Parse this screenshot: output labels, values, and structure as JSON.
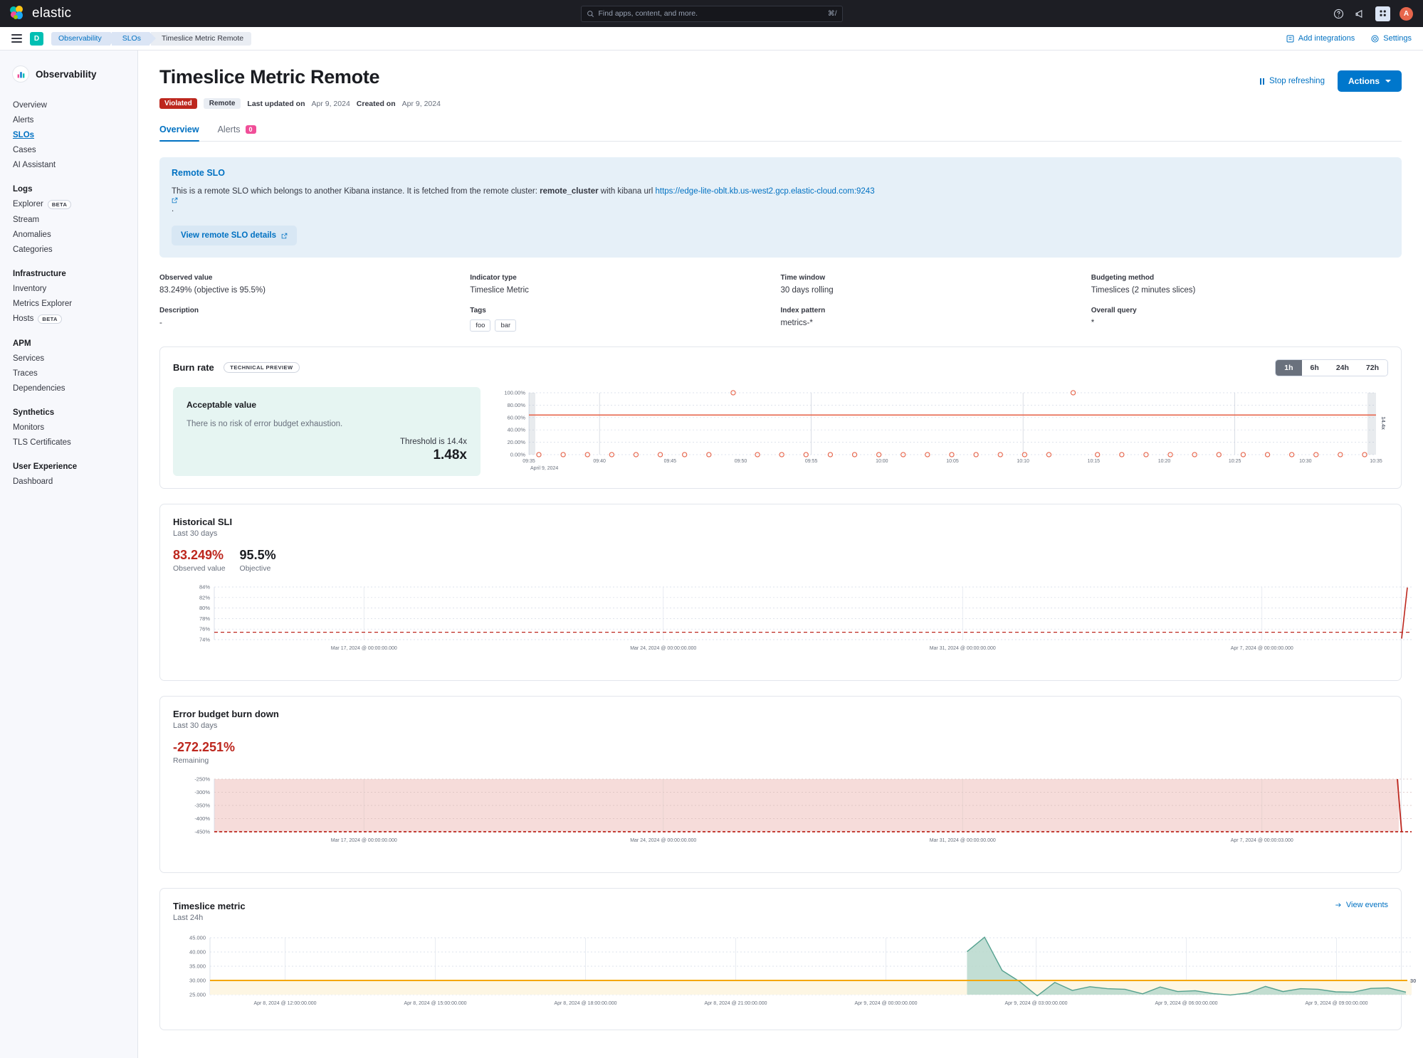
{
  "topbar": {
    "brand": "elastic",
    "search_placeholder": "Find apps, content, and more.",
    "search_shortcut": "⌘/",
    "avatar_initial": "A"
  },
  "breadcrumbs": {
    "space_initial": "D",
    "items": [
      "Observability",
      "SLOs",
      "Timeslice Metric Remote"
    ],
    "add_integrations": "Add integrations",
    "settings": "Settings"
  },
  "sidebar": {
    "title": "Observability",
    "top_items": [
      {
        "label": "Overview",
        "active": false
      },
      {
        "label": "Alerts",
        "active": false
      },
      {
        "label": "SLOs",
        "active": true
      },
      {
        "label": "Cases",
        "active": false
      },
      {
        "label": "AI Assistant",
        "active": false
      }
    ],
    "groups": [
      {
        "title": "Logs",
        "items": [
          {
            "label": "Explorer",
            "badge": "BETA"
          },
          {
            "label": "Stream",
            "badge": ""
          },
          {
            "label": "Anomalies",
            "badge": ""
          },
          {
            "label": "Categories",
            "badge": ""
          }
        ]
      },
      {
        "title": "Infrastructure",
        "items": [
          {
            "label": "Inventory",
            "badge": ""
          },
          {
            "label": "Metrics Explorer",
            "badge": ""
          },
          {
            "label": "Hosts",
            "badge": "BETA"
          }
        ]
      },
      {
        "title": "APM",
        "items": [
          {
            "label": "Services",
            "badge": ""
          },
          {
            "label": "Traces",
            "badge": ""
          },
          {
            "label": "Dependencies",
            "badge": ""
          }
        ]
      },
      {
        "title": "Synthetics",
        "items": [
          {
            "label": "Monitors",
            "badge": ""
          },
          {
            "label": "TLS Certificates",
            "badge": ""
          }
        ]
      },
      {
        "title": "User Experience",
        "items": [
          {
            "label": "Dashboard",
            "badge": ""
          }
        ]
      }
    ]
  },
  "header": {
    "title": "Timeslice Metric Remote",
    "status_badge": "Violated",
    "remote_badge": "Remote",
    "last_updated_label": "Last updated on",
    "last_updated_value": "Apr 9, 2024",
    "created_label": "Created on",
    "created_value": "Apr 9, 2024",
    "stop_refreshing": "Stop refreshing",
    "actions": "Actions"
  },
  "tabs": [
    {
      "label": "Overview",
      "count": "",
      "active": true
    },
    {
      "label": "Alerts",
      "count": "0",
      "active": false
    }
  ],
  "callout": {
    "title": "Remote SLO",
    "body_pre": "This is a remote SLO which belongs to another Kibana instance. It is fetched from the remote cluster: ",
    "cluster": "remote_cluster",
    "body_mid": " with kibana url ",
    "url": "https://edge-lite-oblt.kb.us-west2.gcp.elastic-cloud.com:9243",
    "body_post": ".",
    "button": "View remote SLO details"
  },
  "meta": [
    {
      "label": "Observed value",
      "value": "83.249% (objective is 95.5%)"
    },
    {
      "label": "Indicator type",
      "value": "Timeslice Metric"
    },
    {
      "label": "Time window",
      "value": "30 days rolling"
    },
    {
      "label": "Budgeting method",
      "value": "Timeslices (2 minutes slices)"
    },
    {
      "label": "Description",
      "value": "-"
    },
    {
      "label": "Tags",
      "value": "",
      "tags": [
        "foo",
        "bar"
      ]
    },
    {
      "label": "Index pattern",
      "value": "metrics-*"
    },
    {
      "label": "Overall query",
      "value": "*"
    }
  ],
  "burn_rate": {
    "title": "Burn rate",
    "tech_preview": "TECHNICAL PREVIEW",
    "time_buttons": [
      {
        "label": "1h",
        "active": true
      },
      {
        "label": "6h",
        "active": false
      },
      {
        "label": "24h",
        "active": false
      },
      {
        "label": "72h",
        "active": false
      }
    ],
    "card_title": "Acceptable value",
    "card_body": "There is no risk of error budget exhaustion.",
    "threshold_label": "Threshold is 14.4x",
    "threshold_value": "1.48x"
  },
  "historical_sli": {
    "title": "Historical SLI",
    "subtitle": "Last 30 days",
    "observed_value": "83.249%",
    "observed_label": "Observed value",
    "objective_value": "95.5%",
    "objective_label": "Objective"
  },
  "error_budget": {
    "title": "Error budget burn down",
    "subtitle": "Last 30 days",
    "remaining_value": "-272.251%",
    "remaining_label": "Remaining"
  },
  "timeslice_metric": {
    "title": "Timeslice metric",
    "subtitle": "Last 24h",
    "view_events": "View events"
  },
  "colors": {
    "accent": "#0071c2",
    "danger": "#bd271e",
    "success": "#00bfb3",
    "warning": "#f5a700",
    "teal_fill": "#98c9bc"
  },
  "chart_data": [
    {
      "id": "burn_rate_chart",
      "type": "scatter",
      "title": "Burn rate",
      "ylabel": "",
      "xlabel": "April 9, 2024",
      "ylim": [
        0,
        100
      ],
      "ytick_labels": [
        "100.00%",
        "80.00%",
        "60.00%",
        "40.00%",
        "20.00%",
        "0.00%"
      ],
      "ytick_values": [
        100,
        80,
        60,
        40,
        20,
        0
      ],
      "xtick_labels": [
        "09:35",
        "09:40",
        "09:45",
        "09:50",
        "09:55",
        "10:00",
        "10:05",
        "10:10",
        "10:15",
        "10:20",
        "10:25",
        "10:30",
        "10:35"
      ],
      "threshold_line": {
        "value": 64,
        "label": "14.4x",
        "color": "#e7664c"
      },
      "grid": true,
      "values": [
        0,
        0,
        0,
        0,
        0,
        0,
        0,
        0,
        100,
        0,
        0,
        0,
        0,
        0,
        0,
        0,
        0,
        0,
        0,
        0,
        0,
        0,
        100,
        0,
        0,
        0,
        0,
        0,
        0,
        0,
        0,
        0,
        0,
        0,
        0
      ]
    },
    {
      "id": "historical_sli_chart",
      "type": "line",
      "title": "Historical SLI",
      "ylim": [
        74,
        84
      ],
      "ytick_labels": [
        "84%",
        "82%",
        "80%",
        "78%",
        "76%",
        "74%"
      ],
      "ytick_values": [
        84,
        82,
        80,
        78,
        76,
        74
      ],
      "xtick_labels": [
        "Mar 17, 2024 @ 00:00:00.000",
        "Mar 24, 2024 @ 00:00:00.000",
        "Mar 31, 2024 @ 00:00:00.000",
        "Apr 7, 2024 @ 00:00:00.000"
      ],
      "objective_line": {
        "value": 95.5,
        "display_y": 75.4,
        "color": "#bd271e",
        "dashed": true
      },
      "series": [
        {
          "name": "SLI",
          "color": "#bd271e",
          "values": [
            null,
            null,
            null,
            74.2,
            83.2
          ]
        }
      ],
      "grid": true
    },
    {
      "id": "error_budget_chart",
      "type": "area",
      "title": "Error budget burn down",
      "ylim": [
        -450,
        -250
      ],
      "ytick_labels": [
        "-250%",
        "-300%",
        "-350%",
        "-400%",
        "-450%"
      ],
      "ytick_values": [
        -250,
        -300,
        -350,
        -400,
        -450
      ],
      "xtick_labels": [
        "Mar 17, 2024 @ 00:00:00.000",
        "Mar 24, 2024 @ 00:00:00.000",
        "Mar 31, 2024 @ 00:00:00.000",
        "Apr 7, 2024 @ 00:00:03.000"
      ],
      "threshold_line": {
        "value": -450,
        "color": "#bd271e",
        "dashed": true
      },
      "series": [
        {
          "name": "Remaining",
          "color": "#bd271e",
          "values": [
            -250,
            -250,
            -250,
            -250,
            -272.251,
            -450
          ]
        }
      ],
      "grid": true
    },
    {
      "id": "timeslice_metric_chart",
      "type": "area",
      "title": "Timeslice metric",
      "ylim": [
        25000,
        45000
      ],
      "ytick_labels": [
        "45.000",
        "40.000",
        "35.000",
        "30.000",
        "25.000"
      ],
      "ytick_values": [
        45000,
        40000,
        35000,
        30000,
        25000
      ],
      "xtick_labels": [
        "Apr 8, 2024 @ 12:00:00.000",
        "Apr 8, 2024 @ 15:00:00.000",
        "Apr 8, 2024 @ 18:00:00.000",
        "Apr 8, 2024 @ 21:00:00.000",
        "Apr 9, 2024 @ 00:00:00.000",
        "Apr 9, 2024 @ 03:00:00.000",
        "Apr 9, 2024 @ 06:00:00.000",
        "Apr 9, 2024 @ 09:00:00.000"
      ],
      "threshold_line": {
        "value": 30000,
        "label": "30",
        "color": "#f5a700"
      },
      "series": [
        {
          "name": "metric",
          "color": "#54a18f",
          "values": [
            40100,
            45200,
            33500,
            29600,
            24600,
            29300,
            26500,
            27800,
            27100,
            26900,
            25300,
            27700,
            26100,
            26400,
            25400,
            24900,
            25600,
            27900,
            26100,
            27100,
            26900,
            26000,
            25900,
            27200,
            27400,
            25900
          ]
        }
      ],
      "grid": true
    }
  ]
}
